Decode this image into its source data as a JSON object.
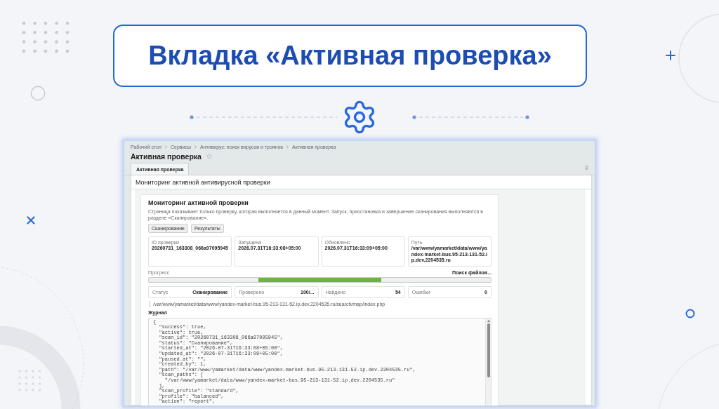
{
  "slide": {
    "title": "Вкладка «Активная проверка»"
  },
  "screenshot": {
    "breadcrumbs": [
      "Рабочий стол",
      "Сервисы",
      "Антивирус: поиск вирусов и троянов",
      "Активная проверка"
    ],
    "page_title": "Активная проверка",
    "favorite": false,
    "tabs": [
      {
        "label": "Активная проверка",
        "selected": true
      }
    ],
    "panel": {
      "title": "Мониторинг активной антивирусной проверки",
      "card": {
        "title": "Мониторинг активной проверки",
        "description": "Страница показывает только проверку, которая выполняется в данный момент. Запуск, приостановка и завершение сканирования выполняются в разделе «Сканирование».",
        "buttons": [
          "Сканирование",
          "Результаты"
        ],
        "info": [
          {
            "label": "ID проверки",
            "value": "20260731_163308_066a97095945"
          },
          {
            "label": "Запущена",
            "value": "2026.07.31T16:33:08+05:00"
          },
          {
            "label": "Обновлено",
            "value": "2026.07.31T16:33:09+05:00"
          },
          {
            "label": "Путь",
            "value": "/var/www/yamarket/data/www/yandex-market-bus.95-213-131-52.ip.dev.2204535.ru"
          }
        ],
        "progress": {
          "label": "Прогресс",
          "status": "Поиск файлов...",
          "indeterminate": true
        },
        "stats": [
          {
            "label": "Статус",
            "value": "Сканирование"
          },
          {
            "label": "Проверено",
            "value": "100/..."
          },
          {
            "label": "Найдено",
            "value": "54"
          },
          {
            "label": "Ошибки",
            "value": "0"
          }
        ],
        "current_file": "/var/www/yamarket/data/www/yandex-market-bus.95-213-131-52.ip.dev.2204535.ru/search/map/index.php",
        "log": {
          "title": "Журнал",
          "lines": [
            "{",
            "  \"success\": true,",
            "  \"active\": true,",
            "  \"scan_id\": \"20260731_163308_066a97095945\",",
            "  \"status\": \"Сканирование\",",
            "  \"started_at\": \"2026-07-31T16:33:08+05:00\",",
            "  \"updated_at\": \"2026-07-31T16:33:09+05:00\",",
            "  \"paused_at\": \"\",",
            "  \"created_by\": 1,",
            "  \"path\": \"/var/www/yamarket/data/www/yandex-market-bus.95-213-131-52.ip.dev.2204535.ru\",",
            "  \"scan_paths\": [",
            "    \"/var/www/yamarket/data/www/yandex-market-bus.95-213-131-52.ip.dev.2204535.ru\"",
            "  ],",
            "  \"scan_profile\": \"standard\",",
            "  \"profile\": \"balanced\",",
            "  \"action\": \"report\","
          ]
        }
      }
    }
  }
}
